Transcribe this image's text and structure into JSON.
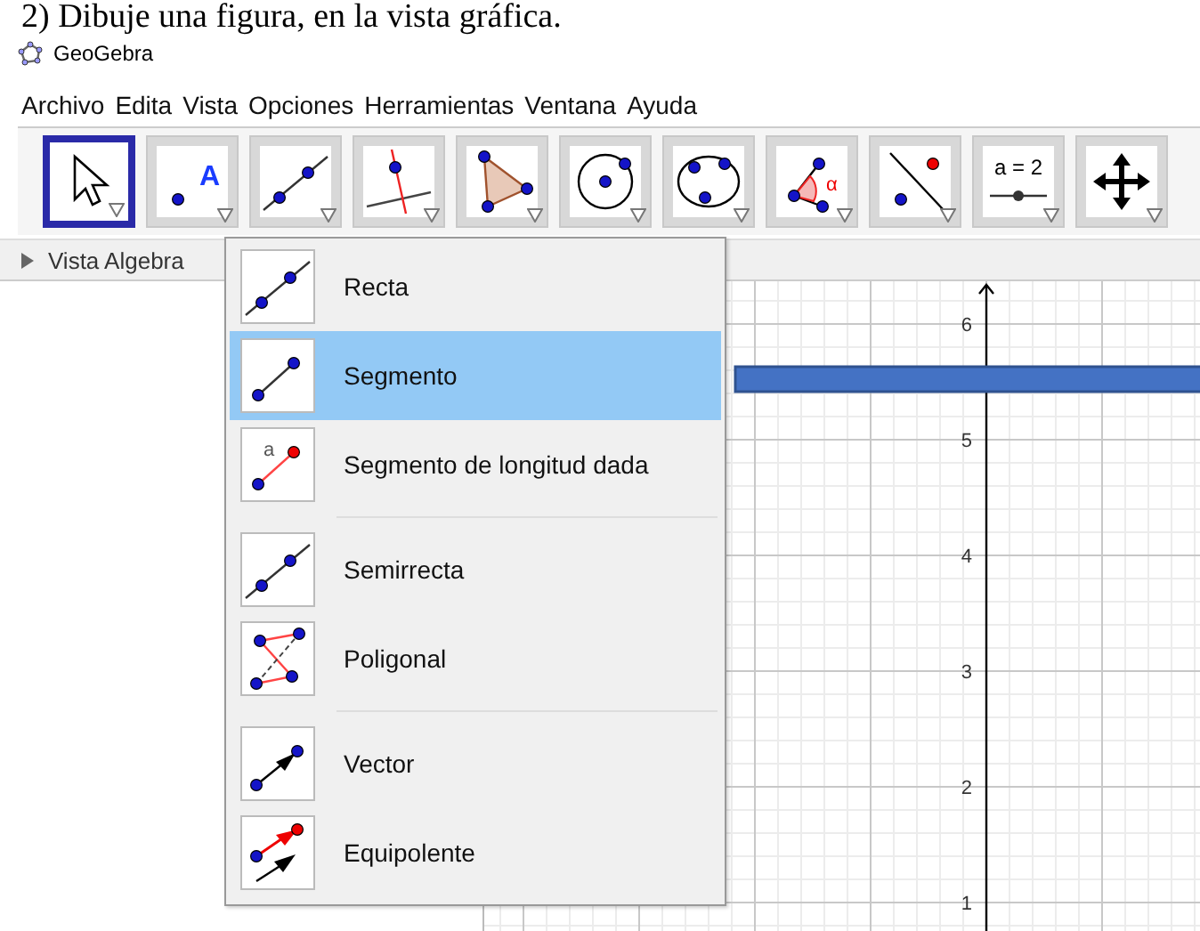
{
  "heading": "2) Dibuje una figura, en la vista gráfica.",
  "window": {
    "title": "GeoGebra"
  },
  "menu_bar": [
    "Archivo",
    "Edita",
    "Vista",
    "Opciones",
    "Herramientas",
    "Ventana",
    "Ayuda"
  ],
  "toolbar": [
    {
      "kind": "move",
      "selected": true
    },
    {
      "kind": "point",
      "label": "A",
      "selected": false
    },
    {
      "kind": "line",
      "selected": false
    },
    {
      "kind": "perpendicular",
      "selected": false
    },
    {
      "kind": "polygon",
      "selected": false
    },
    {
      "kind": "circle",
      "selected": false
    },
    {
      "kind": "conic",
      "selected": false
    },
    {
      "kind": "angle",
      "label": "α",
      "selected": false
    },
    {
      "kind": "reflect",
      "selected": false
    },
    {
      "kind": "slider",
      "label": "a = 2",
      "selected": false
    },
    {
      "kind": "pan",
      "selected": false
    }
  ],
  "algebra_view": {
    "title": "Vista Algebra"
  },
  "graphics_view": {
    "y_axis_labels": [
      "6",
      "5",
      "4",
      "3",
      "2",
      "1"
    ]
  },
  "dropdown": {
    "groups": [
      [
        {
          "kind": "line",
          "label": "Recta",
          "selected": false
        },
        {
          "kind": "segment",
          "label": "Segmento",
          "selected": true
        },
        {
          "kind": "segment-fixed",
          "icon_label": "a",
          "label": "Segmento de longitud dada",
          "selected": false
        }
      ],
      [
        {
          "kind": "ray",
          "label": "Semirrecta",
          "selected": false
        },
        {
          "kind": "polyline",
          "label": "Poligonal",
          "selected": false
        }
      ],
      [
        {
          "kind": "vector",
          "label": "Vector",
          "selected": false
        },
        {
          "kind": "vector-from-point",
          "label": "Equipolente",
          "selected": false
        }
      ]
    ]
  }
}
